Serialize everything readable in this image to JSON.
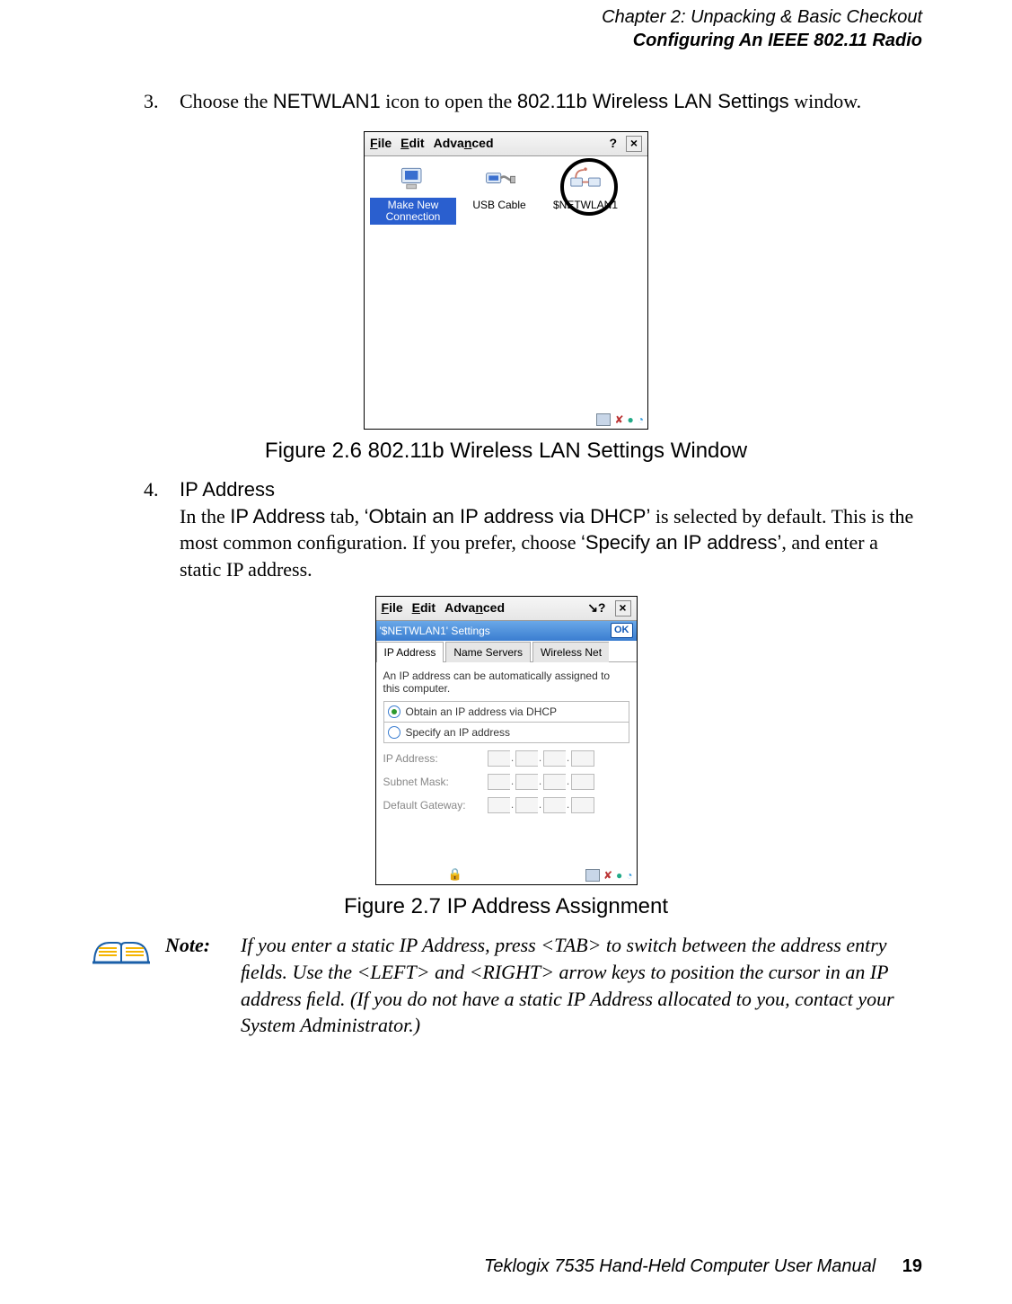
{
  "header": {
    "line1": "Chapter  2:  Unpacking & Basic Checkout",
    "line2": "Configuring An IEEE 802.11 Radio"
  },
  "steps": {
    "s3": {
      "num": "3.",
      "text_prefix": "Choose the ",
      "netwlan": "NETWLAN1",
      "text_mid": " icon to open the ",
      "settings": "802.11b Wireless LAN Settings",
      "text_suffix": " window."
    },
    "s4": {
      "num": "4.",
      "title": "IP Address",
      "line1_a": "In the ",
      "line1_b": "IP Address",
      "line1_c": " tab, ",
      "line1_d": "‘Obtain an IP address via DHCP’",
      "line1_e": " is selected by default. This is the most common conﬁguration. If you prefer, choose ",
      "line1_f": "‘Specify an IP address’",
      "line1_g": ", and enter a static IP address."
    }
  },
  "figcaptions": {
    "f26": "Figure 2.6 802.11b Wireless LAN Settings Window",
    "f27": "Figure 2.7 IP Address Assignment"
  },
  "shot1": {
    "menu_file": "File",
    "menu_edit": "Edit",
    "menu_adv": "Advanced",
    "help": "?",
    "close": "×",
    "icon1": "Make New Connection",
    "icon2": "USB Cable",
    "icon3": "$NETWLAN1"
  },
  "shot2": {
    "menu_file": "File",
    "menu_edit": "Edit",
    "menu_adv": "Advanced",
    "help": "?",
    "close": "×",
    "title": "'$NETWLAN1' Settings",
    "ok": "OK",
    "tab1": "IP Address",
    "tab2": "Name Servers",
    "tab3": "Wireless Net",
    "hint": "An IP address can be automatically assigned to this computer.",
    "radio1": "Obtain an IP address via DHCP",
    "radio2": "Specify an IP address",
    "field1": "IP Address:",
    "field2": "Subnet Mask:",
    "field3": "Default Gateway:"
  },
  "note": {
    "label": "Note:",
    "text": "If you enter a static IP Address, press <TAB> to switch between the address entry ﬁelds. Use the <LEFT> and <RIGHT> arrow keys to position the cursor in an IP address ﬁeld. (If you do not have a static IP Address allocated to you, contact your System Administrator.)"
  },
  "footer": {
    "title": "Teklogix 7535 Hand-Held Computer User Manual",
    "page": "19"
  }
}
